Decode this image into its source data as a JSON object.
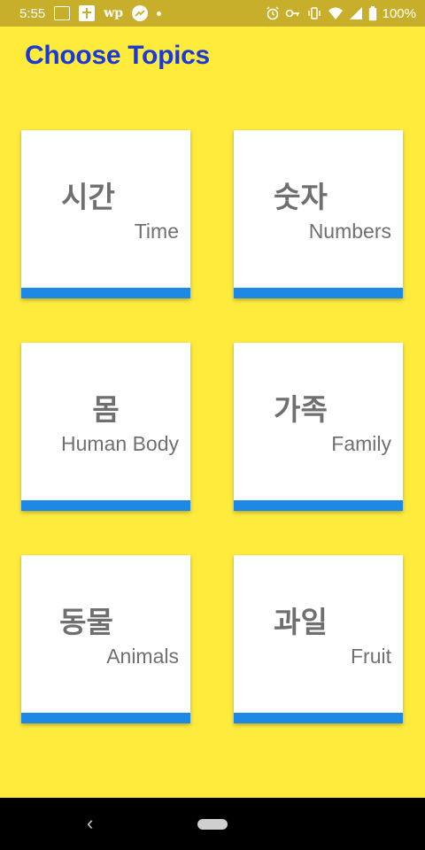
{
  "status_bar": {
    "time": "5:55",
    "notification_icons": [
      "news-icon",
      "app-cross-icon",
      "wp-icon",
      "trending-icon",
      "dot-icon"
    ],
    "wp_text": "wp",
    "system_icons": [
      "alarm-icon",
      "key-icon",
      "vibrate-icon",
      "wifi-icon",
      "signal-icon",
      "battery-icon"
    ],
    "battery": "100%",
    "background": "#c8af2b"
  },
  "app": {
    "title": "Choose Topics",
    "background": "#ffeb3b",
    "title_color": "#1a39d8",
    "accent_color": "#1e88e5"
  },
  "topics": [
    {
      "korean": "시간",
      "english": "Time"
    },
    {
      "korean": "숫자",
      "english": "Numbers"
    },
    {
      "korean": "몸",
      "english": "Human Body"
    },
    {
      "korean": "가족",
      "english": "Family"
    },
    {
      "korean": "동물",
      "english": "Animals"
    },
    {
      "korean": "과일",
      "english": "Fruit"
    }
  ],
  "nav_bar": {
    "back_label": "‹"
  }
}
